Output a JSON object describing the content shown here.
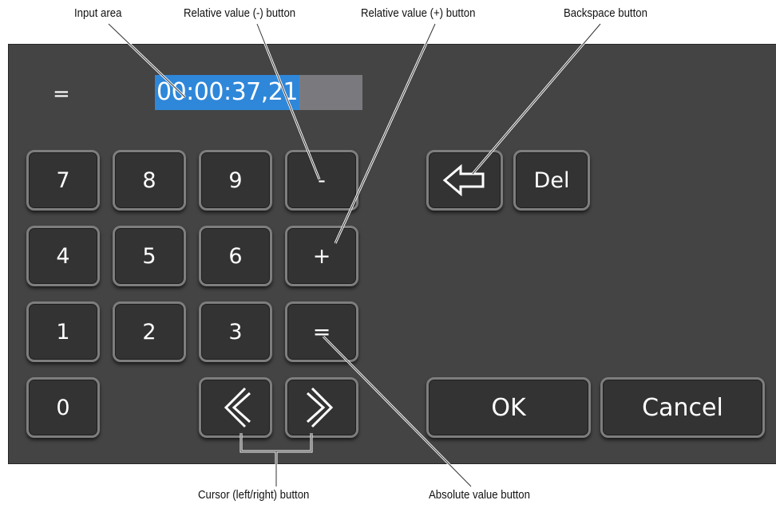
{
  "callouts": {
    "input_area": "Input area",
    "relative_minus": "Relative value (-) button",
    "relative_plus": "Relative value (+) button",
    "backspace": "Backspace button",
    "cursor": "Cursor (left/right) button",
    "absolute": "Absolute value button"
  },
  "input": {
    "mode": "=",
    "value": "00:00:37,21"
  },
  "keypad": {
    "k7": "7",
    "k8": "8",
    "k9": "9",
    "minus": "-",
    "k4": "4",
    "k5": "5",
    "k6": "6",
    "plus": "+",
    "k1": "1",
    "k2": "2",
    "k3": "3",
    "equals": "=",
    "k0": "0"
  },
  "actions": {
    "del": "Del",
    "ok": "OK",
    "cancel": "Cancel"
  },
  "icons": {
    "backspace": "backspace-arrow-icon",
    "cursor_left": "chevron-left-icon",
    "cursor_right": "chevron-right-icon"
  }
}
